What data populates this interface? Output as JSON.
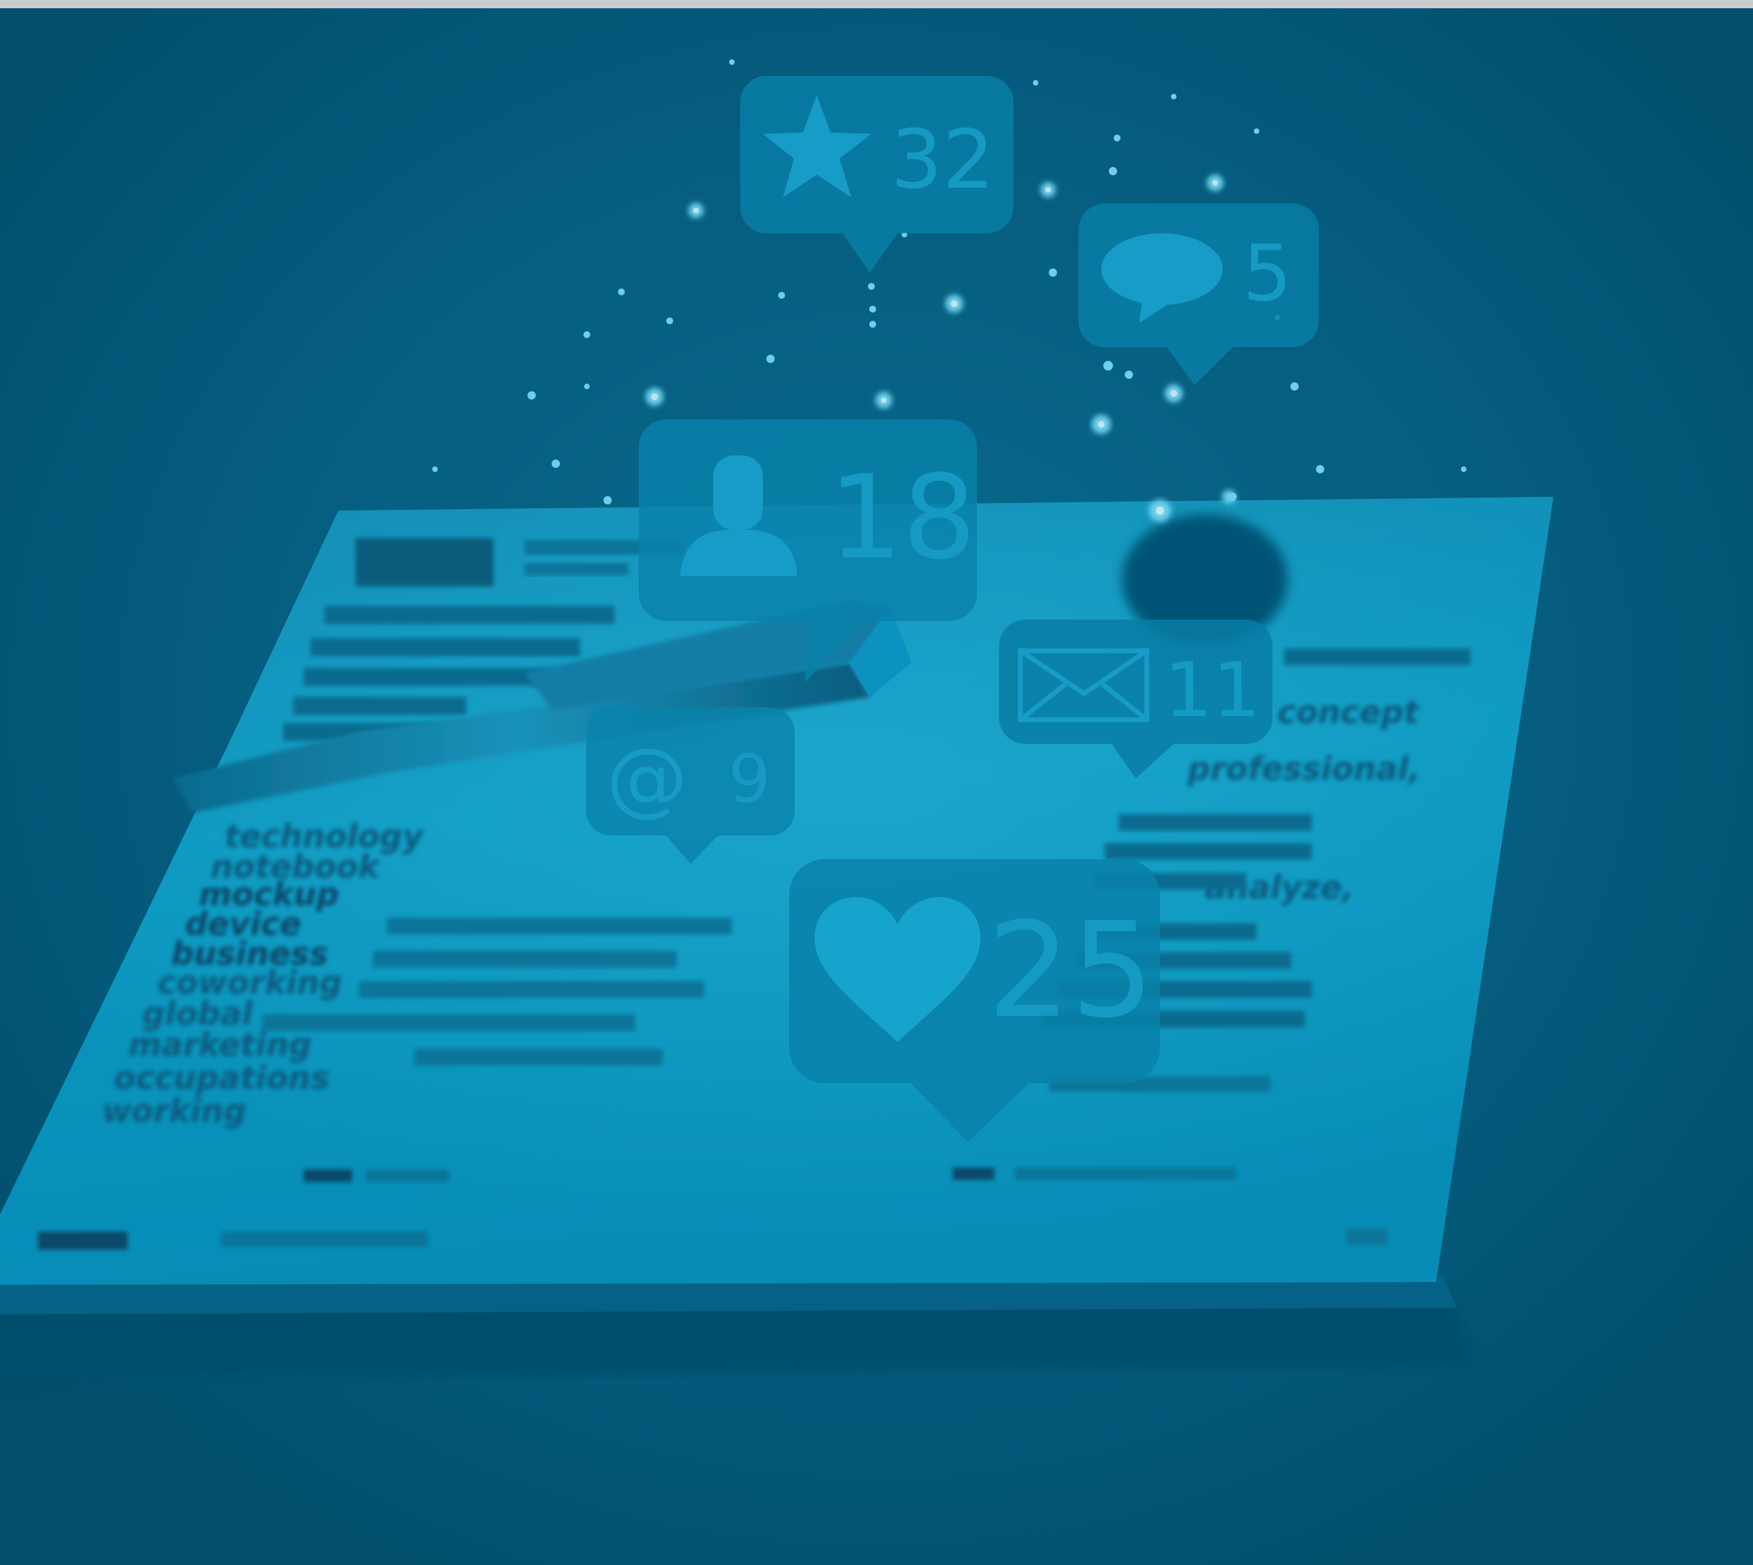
{
  "image": {
    "top_strip_color": "#c9cdd0",
    "background_color": "#045b7c",
    "tint_color": "#0aa6cf"
  },
  "phone_screen": {
    "blurred_words": [
      "technology",
      "notebook",
      "mockup",
      "device",
      "business",
      "coworking",
      "global",
      "marketing",
      "occupations",
      "working",
      "professional,",
      "analyze,",
      "concept"
    ]
  },
  "notifications": {
    "star": {
      "icon": "star-icon",
      "count": "32"
    },
    "chat": {
      "icon": "speech-bubble-icon",
      "count": "5"
    },
    "followers": {
      "icon": "person-icon",
      "count": "18"
    },
    "messages": {
      "icon": "envelope-icon",
      "count": "11"
    },
    "mentions": {
      "icon": "at-sign-icon",
      "count": "9"
    },
    "likes": {
      "icon": "heart-icon",
      "count": "25"
    }
  }
}
